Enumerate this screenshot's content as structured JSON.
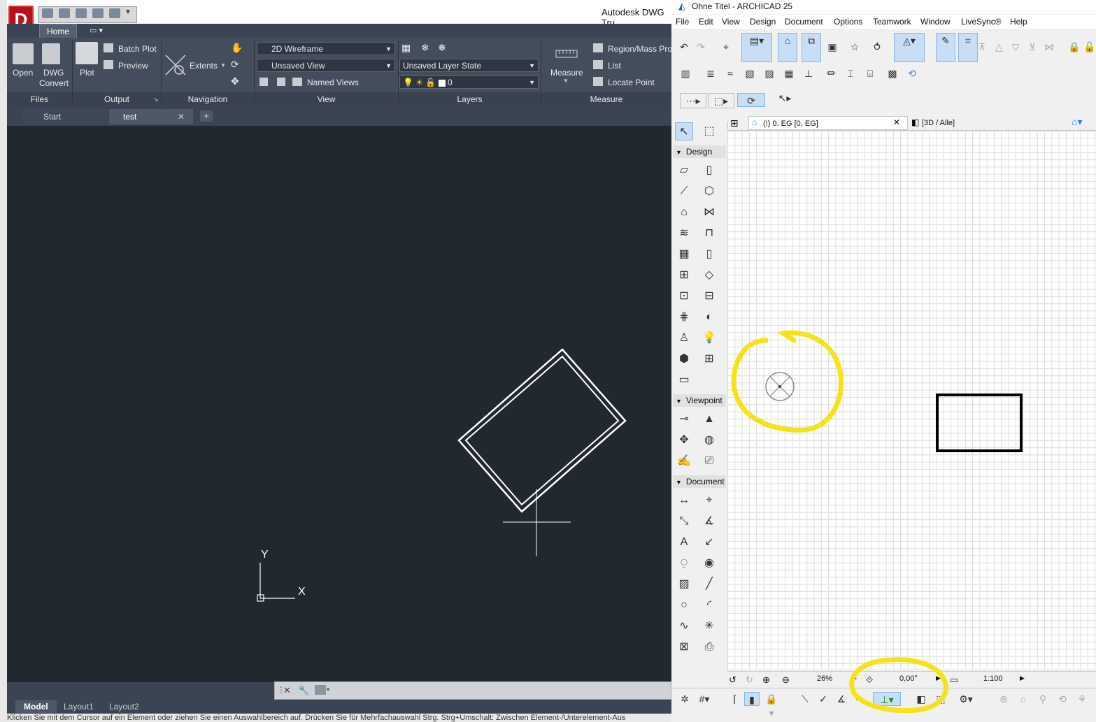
{
  "dwg": {
    "app_title": "Autodesk DWG Tru",
    "logo": "D",
    "ribbon_tabs": [
      "Home"
    ],
    "files": {
      "open": "Open",
      "dwg_convert_1": "DWG",
      "dwg_convert_2": "Convert",
      "panel": "Files"
    },
    "output": {
      "plot": "Plot",
      "batch_plot": "Batch Plot",
      "preview": "Preview",
      "panel": "Output"
    },
    "navigation": {
      "extents": "Extents",
      "panel": "Navigation"
    },
    "view": {
      "visual_style": "2D Wireframe",
      "saved_view": "Unsaved View",
      "named_views": "Named Views",
      "panel": "View"
    },
    "layers": {
      "layer_state": "Unsaved Layer State",
      "current_layer": "0",
      "panel": "Layers"
    },
    "measure": {
      "measure": "Measure",
      "region_mass": "Region/Mass Pro",
      "list": "List",
      "locate_point": "Locate Point",
      "panel": "Measure"
    },
    "doc_tabs": {
      "start": "Start",
      "test": "test"
    },
    "ucs": {
      "y": "Y",
      "x": "X"
    },
    "layout_tabs": [
      "Model",
      "Layout1",
      "Layout2"
    ],
    "status_text": "Klicken Sie mit dem Cursor auf ein Element oder ziehen Sie einen Auswahlbereich auf. Drücken Sie für Mehrfachauswahl Strg. Strg+Umschalt: Zwischen Element-/Unterelement-Aus"
  },
  "archicad": {
    "title": "Ohne Titel - ARCHICAD 25",
    "menus": [
      "File",
      "Edit",
      "View",
      "Design",
      "Document",
      "Options",
      "Teamwork",
      "Window",
      "LiveSync®",
      "Help"
    ],
    "tabs": {
      "floor_plan": "(!) 0. EG [0. EG]",
      "view_3d": "[3D / Alle]"
    },
    "toolbox_sections": {
      "design": "Design",
      "viewpoint": "Viewpoint",
      "document": "Document"
    },
    "nav": {
      "zoom": "26%",
      "angle": "0,00°",
      "scale": "1:100"
    }
  },
  "colors": {
    "highlight": "#f5e31a",
    "dwg_canvas": "#212830",
    "accent": "#86b6e8"
  }
}
